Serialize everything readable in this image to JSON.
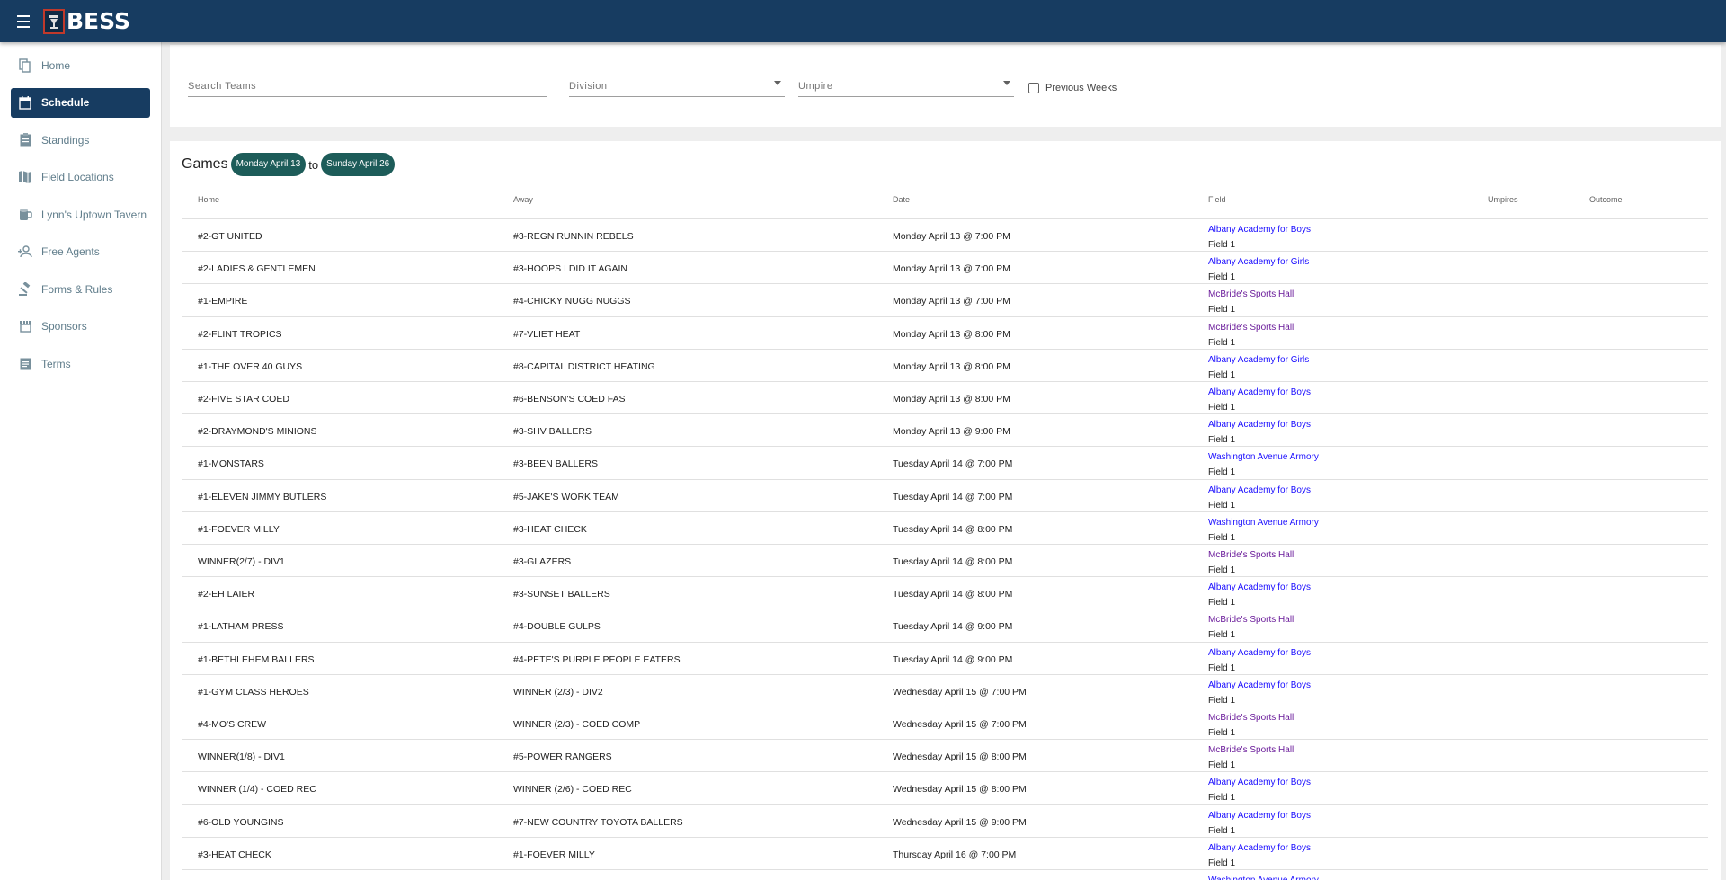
{
  "app": {
    "name": "BESS"
  },
  "nav": [
    {
      "id": "home",
      "label": "Home",
      "icon": "copy-icon"
    },
    {
      "id": "schedule",
      "label": "Schedule",
      "icon": "calendar-icon",
      "active": true
    },
    {
      "id": "standings",
      "label": "Standings",
      "icon": "clipboard-icon"
    },
    {
      "id": "field-locations",
      "label": "Field Locations",
      "icon": "map-icon"
    },
    {
      "id": "tavern",
      "label": "Lynn's Uptown Tavern",
      "icon": "mug-icon"
    },
    {
      "id": "free-agents",
      "label": "Free Agents",
      "icon": "person-add-icon"
    },
    {
      "id": "forms-rules",
      "label": "Forms & Rules",
      "icon": "gavel-icon"
    },
    {
      "id": "sponsors",
      "label": "Sponsors",
      "icon": "store-icon"
    },
    {
      "id": "terms",
      "label": "Terms",
      "icon": "document-icon"
    }
  ],
  "filters": {
    "search_placeholder": "Search Teams",
    "division_placeholder": "Division",
    "umpire_placeholder": "Umpire",
    "previous_weeks_label": "Previous Weeks"
  },
  "games": {
    "title": "Games",
    "start_label": "Monday April 13",
    "to_label": "to",
    "end_label": "Sunday April 26",
    "columns": {
      "home": "Home",
      "away": "Away",
      "date": "Date",
      "field": "Field",
      "umpires": "Umpires",
      "outcome": "Outcome"
    },
    "colors": {
      "link_blue": "#1a0dff",
      "link_visited": "#6a1b9a"
    },
    "rows": [
      {
        "home": "#2-GT UNITED",
        "away": "#3-REGN RUNNIN REBELS",
        "date": "Monday April 13 @ 7:00 PM",
        "location": "Albany Academy for Boys",
        "field": "Field 1",
        "visited": false
      },
      {
        "home": "#2-LADIES & GENTLEMEN",
        "away": "#3-HOOPS I DID IT AGAIN",
        "date": "Monday April 13 @ 7:00 PM",
        "location": "Albany Academy for Girls",
        "field": "Field 1",
        "visited": false
      },
      {
        "home": "#1-EMPIRE",
        "away": "#4-CHICKY NUGG NUGGS",
        "date": "Monday April 13 @ 7:00 PM",
        "location": "McBride's Sports Hall",
        "field": "Field 1",
        "visited": true
      },
      {
        "home": "#2-FLINT TROPICS",
        "away": "#7-VLIET HEAT",
        "date": "Monday April 13 @ 8:00 PM",
        "location": "McBride's Sports Hall",
        "field": "Field 1",
        "visited": true
      },
      {
        "home": "#1-THE OVER 40 GUYS",
        "away": "#8-CAPITAL DISTRICT HEATING",
        "date": "Monday April 13 @ 8:00 PM",
        "location": "Albany Academy for Girls",
        "field": "Field 1",
        "visited": false
      },
      {
        "home": "#2-FIVE STAR COED",
        "away": "#6-BENSON'S COED FAS",
        "date": "Monday April 13 @ 8:00 PM",
        "location": "Albany Academy for Boys",
        "field": "Field 1",
        "visited": false
      },
      {
        "home": "#2-DRAYMOND'S MINIONS",
        "away": "#3-SHV BALLERS",
        "date": "Monday April 13 @ 9:00 PM",
        "location": "Albany Academy for Boys",
        "field": "Field 1",
        "visited": false
      },
      {
        "home": "#1-MONSTARS",
        "away": "#3-BEEN BALLERS",
        "date": "Tuesday April 14 @ 7:00 PM",
        "location": "Washington Avenue Armory",
        "field": "Field 1",
        "visited": false
      },
      {
        "home": "#1-ELEVEN JIMMY BUTLERS",
        "away": "#5-JAKE'S WORK TEAM",
        "date": "Tuesday April 14 @ 7:00 PM",
        "location": "Albany Academy for Boys",
        "field": "Field 1",
        "visited": false
      },
      {
        "home": "#1-FOEVER MILLY",
        "away": "#3-HEAT CHECK",
        "date": "Tuesday April 14 @ 8:00 PM",
        "location": "Washington Avenue Armory",
        "field": "Field 1",
        "visited": false
      },
      {
        "home": "WINNER(2/7) - DIV1",
        "away": "#3-GLAZERS",
        "date": "Tuesday April 14 @ 8:00 PM",
        "location": "McBride's Sports Hall",
        "field": "Field 1",
        "visited": true
      },
      {
        "home": "#2-EH LAIER",
        "away": "#3-SUNSET BALLERS",
        "date": "Tuesday April 14 @ 8:00 PM",
        "location": "Albany Academy for Boys",
        "field": "Field 1",
        "visited": false
      },
      {
        "home": "#1-LATHAM PRESS",
        "away": "#4-DOUBLE GULPS",
        "date": "Tuesday April 14 @ 9:00 PM",
        "location": "McBride's Sports Hall",
        "field": "Field 1",
        "visited": true
      },
      {
        "home": "#1-BETHLEHEM BALLERS",
        "away": "#4-PETE'S PURPLE PEOPLE EATERS",
        "date": "Tuesday April 14 @ 9:00 PM",
        "location": "Albany Academy for Boys",
        "field": "Field 1",
        "visited": false
      },
      {
        "home": "#1-GYM CLASS HEROES",
        "away": "WINNER (2/3) - DIV2",
        "date": "Wednesday April 15 @ 7:00 PM",
        "location": "Albany Academy for Boys",
        "field": "Field 1",
        "visited": false
      },
      {
        "home": "#4-MO'S CREW",
        "away": "WINNER (2/3) - COED COMP",
        "date": "Wednesday April 15 @ 7:00 PM",
        "location": "McBride's Sports Hall",
        "field": "Field 1",
        "visited": true
      },
      {
        "home": "WINNER(1/8) - DIV1",
        "away": "#5-POWER RANGERS",
        "date": "Wednesday April 15 @ 8:00 PM",
        "location": "McBride's Sports Hall",
        "field": "Field 1",
        "visited": true
      },
      {
        "home": "WINNER (1/4) - COED REC",
        "away": "WINNER (2/6) - COED REC",
        "date": "Wednesday April 15 @ 8:00 PM",
        "location": "Albany Academy for Boys",
        "field": "Field 1",
        "visited": false
      },
      {
        "home": "#6-OLD YOUNGINS",
        "away": "#7-NEW COUNTRY TOYOTA BALLERS",
        "date": "Wednesday April 15 @ 9:00 PM",
        "location": "Albany Academy for Boys",
        "field": "Field 1",
        "visited": false
      },
      {
        "home": "#3-HEAT CHECK",
        "away": "#1-FOEVER MILLY",
        "date": "Thursday April 16 @ 7:00 PM",
        "location": "Albany Academy for Boys",
        "field": "Field 1",
        "visited": false
      },
      {
        "home": "",
        "away": "",
        "date": "",
        "location": "Washington Avenue Armory",
        "field": "",
        "visited": false
      }
    ]
  }
}
